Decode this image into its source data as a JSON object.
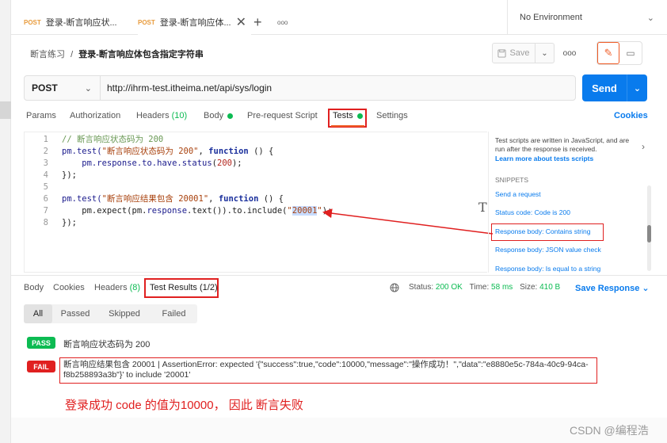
{
  "tabs": [
    {
      "method": "POST",
      "title": "登录-断言响应状...",
      "active": false
    },
    {
      "method": "POST",
      "title": "登录-断言响应体...",
      "active": true
    }
  ],
  "tabbar": {
    "add": "+",
    "more": "ooo",
    "close": "✕"
  },
  "environment": "No Environment",
  "breadcrumb": {
    "collection": "断言练习",
    "sep": "/",
    "request": "登录-断言响应体包含指定字符串"
  },
  "toolbar": {
    "save_label": "Save",
    "more": "ooo"
  },
  "request": {
    "method": "POST",
    "url": "http://ihrm-test.itheima.net/api/sys/login",
    "send_label": "Send"
  },
  "request_tabs": {
    "params": "Params",
    "authorization": "Authorization",
    "headers": "Headers",
    "headers_count": "(10)",
    "body": "Body",
    "prerequest": "Pre-request Script",
    "tests": "Tests",
    "settings": "Settings",
    "cookies": "Cookies"
  },
  "code": {
    "line_numbers": [
      "1",
      "2",
      "3",
      "4",
      "5",
      "6",
      "7",
      "8"
    ],
    "l1_comment": "// 断言响应状态码为 200",
    "l2_a": "pm.test(",
    "l2_str": "\"断言响应状态码为 200\"",
    "l2_b": ", ",
    "l2_kw": "function",
    "l2_c": " () {",
    "l3_a": "    pm.",
    "l3_prop": "response.to.have.status",
    "l3_b": "(",
    "l3_num": "200",
    "l3_c": ");",
    "l4": "});",
    "l6_a": "pm.test(",
    "l6_str": "\"断言响应结果包含 20001\"",
    "l6_b": ", ",
    "l6_kw": "function",
    "l6_c": " () {",
    "l7_a": "    pm.expect(pm.",
    "l7_prop": "response",
    "l7_b": ".text()).to.include(",
    "l7_q1": "\"",
    "l7_hl": "20001",
    "l7_q2": "\"",
    "l7_c": ");",
    "l8": "});"
  },
  "snippets": {
    "intro": "Test scripts are written in JavaScript, and are run after the response is received.",
    "learn_more": "Learn more about tests scripts",
    "heading": "SNIPPETS",
    "items": [
      "Send a request",
      "Status code: Code is 200",
      "Response body: Contains string",
      "Response body: JSON value check",
      "Response body: Is equal to a string"
    ]
  },
  "response_tabs": {
    "body": "Body",
    "cookies": "Cookies",
    "headers": "Headers",
    "headers_count": "(8)",
    "test_results": "Test Results",
    "test_results_count": "(1/2)"
  },
  "response_status": {
    "status_label": "Status:",
    "status_value": "200 OK",
    "time_label": "Time:",
    "time_value": "58 ms",
    "size_label": "Size:",
    "size_value": "410 B",
    "save_response": "Save Response"
  },
  "filters": [
    "All",
    "Passed",
    "Skipped",
    "Failed"
  ],
  "results": [
    {
      "badge": "PASS",
      "text": "断言响应状态码为 200"
    },
    {
      "badge": "FAIL",
      "text": "断言响应结果包含 20001 | AssertionError: expected '{\"success\":true,\"code\":10000,\"message\":\"操作成功！\",\"data\":\"e8880e5c-784a-40c9-94ca-f8b258893a3b\"}' to include '20001'"
    }
  ],
  "annotation": "登录成功 code 的值为10000，  因此 断言失败",
  "watermark": "CSDN @编程浩",
  "colors": {
    "accent": "#ef5b25",
    "send": "#097bed",
    "pass": "#0cbb52",
    "fail": "#e02020",
    "method": "#e89b3c"
  }
}
